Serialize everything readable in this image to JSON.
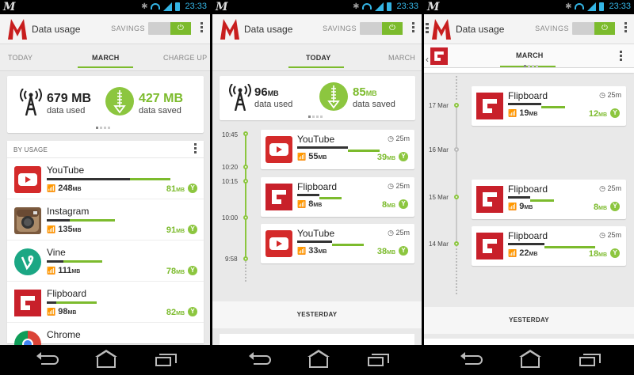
{
  "status": {
    "time": "23:33"
  },
  "app": {
    "title": "Data usage",
    "savings_label": "SAVINGS",
    "toggle_symbol": "⏻"
  },
  "colors": {
    "brand_red": "#c81e1e",
    "accent_green": "#7cbb2d",
    "status_blue": "#34b5e5"
  },
  "screen1": {
    "tabs": [
      "TODAY",
      "MARCH",
      "CHARGE UP"
    ],
    "active_tab": "MARCH",
    "summary": {
      "used_value": "679 MB",
      "used_label": "data used",
      "saved_value": "427 MB",
      "saved_label": "data saved"
    },
    "list_header": "BY USAGE",
    "apps": [
      {
        "name": "YouTube",
        "used": "248",
        "saved": "81",
        "icon": "youtube-icon",
        "used_frac": 0.82,
        "saved_frac": 0.27
      },
      {
        "name": "Instagram",
        "used": "135",
        "saved": "91",
        "icon": "instagram-icon",
        "used_frac": 0.45,
        "saved_frac": 0.3
      },
      {
        "name": "Vine",
        "used": "111",
        "saved": "78",
        "icon": "vine-icon",
        "used_frac": 0.37,
        "saved_frac": 0.26
      },
      {
        "name": "Flipboard",
        "used": "98",
        "saved": "82",
        "icon": "flipboard-icon",
        "used_frac": 0.33,
        "saved_frac": 0.27
      },
      {
        "name": "Chrome",
        "used": "",
        "saved": "",
        "icon": "chrome-icon"
      }
    ],
    "unit": "MB"
  },
  "screen2": {
    "tabs": [
      "TODAY",
      "MARCH"
    ],
    "active_tab": "TODAY",
    "summary": {
      "used_value": "96",
      "used_unit": "MB",
      "used_label": "data used",
      "saved_value": "85",
      "saved_unit": "MB",
      "saved_label": "data saved"
    },
    "times": [
      "10:45",
      "10:20",
      "10:15",
      "10:00",
      "9:58"
    ],
    "sessions": [
      {
        "name": "YouTube",
        "duration": "25m",
        "used": "55",
        "saved": "39",
        "icon": "youtube-icon"
      },
      {
        "name": "Flipboard",
        "duration": "25m",
        "used": "8",
        "saved": "8",
        "icon": "flipboard-icon"
      },
      {
        "name": "YouTube",
        "duration": "25m",
        "used": "33",
        "saved": "38",
        "icon": "youtube-icon"
      }
    ],
    "section": "YESTERDAY",
    "unit": "MB"
  },
  "screen3": {
    "tab": "MARCH",
    "dates": [
      "17 Mar",
      "16 Mar",
      "15 Mar",
      "14 Mar"
    ],
    "sessions": [
      {
        "name": "Flipboard",
        "duration": "25m",
        "used": "19",
        "saved": "12",
        "icon": "flipboard-icon"
      },
      {
        "name": "Flipboard",
        "duration": "25m",
        "used": "9",
        "saved": "8",
        "icon": "flipboard-icon"
      },
      {
        "name": "Flipboard",
        "duration": "25m",
        "used": "22",
        "saved": "18",
        "icon": "flipboard-icon"
      }
    ],
    "section": "YESTERDAY",
    "unit": "MB"
  }
}
